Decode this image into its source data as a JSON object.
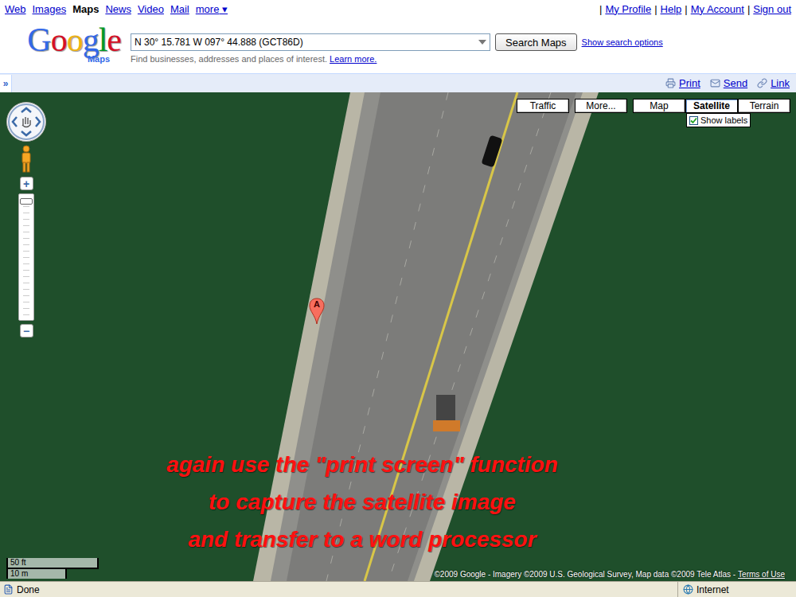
{
  "browser_nav": {
    "links": [
      {
        "label": "Web",
        "selected": false
      },
      {
        "label": "Images",
        "selected": false
      },
      {
        "label": "Maps",
        "selected": true
      },
      {
        "label": "News",
        "selected": false
      },
      {
        "label": "Video",
        "selected": false
      },
      {
        "label": "Mail",
        "selected": false
      }
    ],
    "more": {
      "label": "more",
      "arrow": "▾"
    }
  },
  "account_links": {
    "separator": "|",
    "links": [
      "My Profile",
      "Help",
      "My Account",
      "Sign out"
    ]
  },
  "logo": {
    "word": "Google",
    "product": "Maps"
  },
  "search": {
    "value": "N 30° 15.781 W 097° 44.888 (GCT86D)",
    "button": "Search Maps",
    "options_link": "Show search options",
    "hint": "Find businesses, addresses and places of interest.",
    "hint_link": "Learn more."
  },
  "toolbar": {
    "collapse": "»",
    "actions": [
      "Print",
      "Send",
      "Link"
    ]
  },
  "map_controls": {
    "zoom_in": "+",
    "zoom_out": "−",
    "zoom_level": 0.97
  },
  "map_types": [
    {
      "label": "Traffic",
      "selected": false
    },
    {
      "label": "More...",
      "selected": false
    },
    {
      "label": "Map",
      "selected": false
    },
    {
      "label": "Satellite",
      "selected": true
    },
    {
      "label": "Terrain",
      "selected": false
    }
  ],
  "show_labels": {
    "label": "Show labels",
    "checked": true
  },
  "marker": {
    "label": "A"
  },
  "annotation": {
    "lines": [
      "again use the \"print screen\" function",
      "to capture the satellite image",
      "and transfer to a word processor"
    ]
  },
  "scale": {
    "imperial": "50 ft",
    "metric": "10 m"
  },
  "copyright": {
    "text": "©2009 Google - Imagery ©2009 U.S. Geological Survey, Map data ©2009 Tele Atlas -",
    "link": "Terms of Use"
  },
  "status_bar": {
    "status": "Done",
    "zone": "Internet"
  }
}
